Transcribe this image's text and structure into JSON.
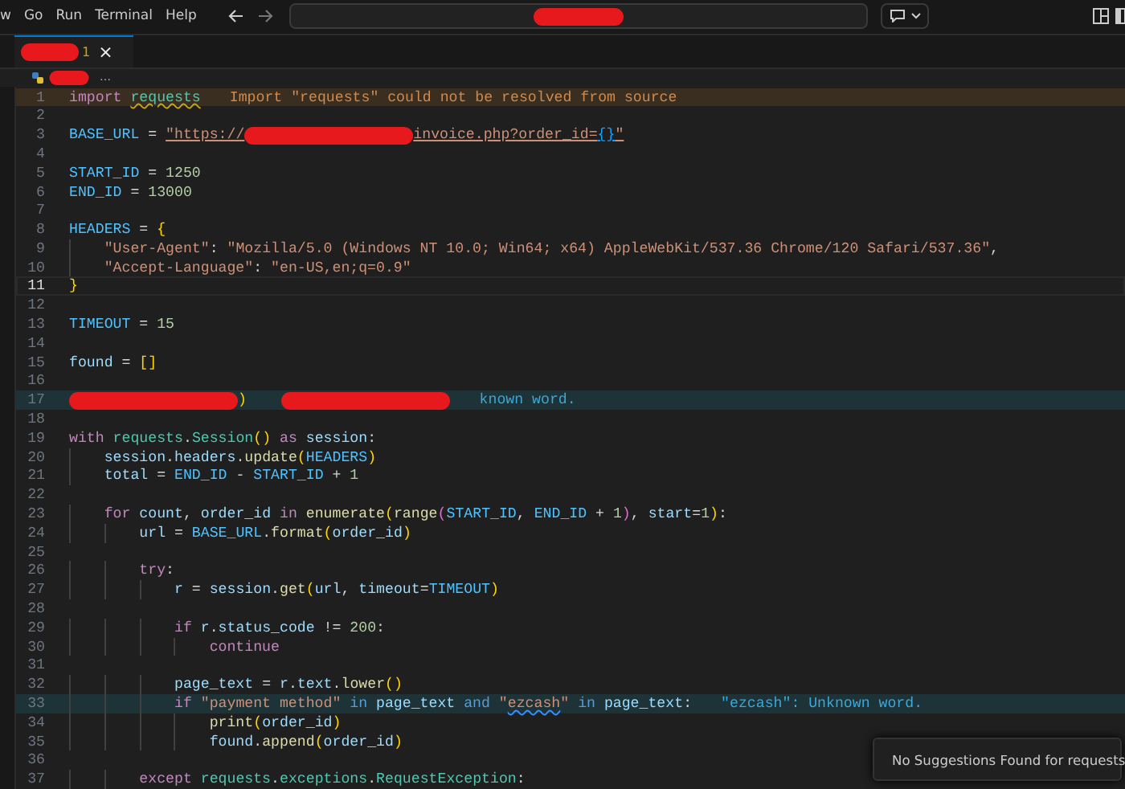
{
  "menu": {
    "items": [
      "w",
      "Go",
      "Run",
      "Terminal",
      "Help"
    ]
  },
  "tab": {
    "problems": "1",
    "close": "×"
  },
  "breadcrumb": {
    "more": "…"
  },
  "editor": {
    "lines": [
      {
        "number": "1",
        "kind": "warning",
        "current": false,
        "tokens": [
          {
            "kind": "kw",
            "text": "import"
          },
          {
            "kind": "mod",
            "text": "requests",
            "space": true,
            "squiggly": true
          }
        ],
        "hint": "Import \"requests\" could not be resolved from source"
      },
      {
        "number": "2",
        "current": false
      },
      {
        "number": "3",
        "current": false,
        "tokens": [
          {
            "kind": "const",
            "text": "BASE_URL"
          },
          {
            "kind": "punc",
            "text": " = "
          },
          {
            "kind": "str",
            "text": "\"https://",
            "underlined": true
          },
          {
            "kind": "redacted"
          },
          {
            "kind": "str",
            "text": "invoice.php?order_id=",
            "underlined": true
          },
          {
            "kind": "br3",
            "text": "{}",
            "underlined": true
          },
          {
            "kind": "str",
            "text": "\"",
            "underlined": true
          }
        ]
      },
      {
        "number": "4",
        "current": false
      },
      {
        "number": "5",
        "current": false,
        "tokens": [
          {
            "kind": "const",
            "text": "START_ID"
          },
          {
            "kind": "punc",
            "text": " = "
          },
          {
            "kind": "num",
            "text": "1250"
          }
        ]
      },
      {
        "number": "6",
        "current": false,
        "tokens": [
          {
            "kind": "const",
            "text": "END_ID"
          },
          {
            "kind": "punc",
            "text": " = "
          },
          {
            "kind": "num",
            "text": "13000"
          }
        ]
      },
      {
        "number": "7",
        "current": false
      },
      {
        "number": "8",
        "current": false,
        "tokens": [
          {
            "kind": "const",
            "text": "HEADERS"
          },
          {
            "kind": "punc",
            "text": " = "
          },
          {
            "kind": "br1",
            "text": "{"
          }
        ],
        "children": [
          {
            "number": "9",
            "current": false,
            "tokens": [
              {
                "kind": "str",
                "text": "\"User-Agent\""
              },
              {
                "kind": "punc",
                "text": ": "
              },
              {
                "kind": "str",
                "text": "\"Mozilla/5.0 (Windows NT 10.0; Win64; x64) AppleWebKit/537.36 Chrome/120 Safari/537.36\""
              },
              {
                "kind": "punc",
                "text": ","
              }
            ]
          },
          {
            "number": "10",
            "current": false,
            "tokens": [
              {
                "kind": "str",
                "text": "\"Accept-Language\""
              },
              {
                "kind": "punc",
                "text": ": "
              },
              {
                "kind": "str",
                "text": "\"en-US,en;q=0.9\""
              }
            ]
          }
        ]
      },
      {
        "number": "11",
        "current": true,
        "tokens": [
          {
            "kind": "br1",
            "text": "}"
          }
        ]
      },
      {
        "number": "12",
        "current": false
      },
      {
        "number": "13",
        "current": false,
        "tokens": [
          {
            "kind": "const",
            "text": "TIMEOUT"
          },
          {
            "kind": "punc",
            "text": " = "
          },
          {
            "kind": "num",
            "text": "15"
          }
        ]
      },
      {
        "number": "14",
        "current": false
      },
      {
        "number": "15",
        "current": false,
        "tokens": [
          {
            "kind": "var",
            "text": "found"
          },
          {
            "kind": "punc",
            "text": " = "
          },
          {
            "kind": "br1",
            "text": "[]"
          }
        ]
      },
      {
        "number": "16",
        "current": false
      },
      {
        "number": "17",
        "kind": "info",
        "current": false,
        "tokens": [
          {
            "kind": "redacted"
          },
          {
            "kind": "br1",
            "text": ")"
          },
          {
            "kind": "redacted",
            "space": true
          }
        ],
        "hint": "known word."
      },
      {
        "number": "18",
        "current": false
      },
      {
        "number": "19",
        "current": false,
        "tokens": [
          {
            "kind": "kw",
            "text": "with"
          },
          {
            "kind": "mod",
            "text": "requests",
            "space": true
          },
          {
            "kind": "punc",
            "text": "."
          },
          {
            "kind": "mod",
            "text": "Session"
          },
          {
            "kind": "br1",
            "text": "()"
          },
          {
            "kind": "kw",
            "text": "as",
            "space": true
          },
          {
            "kind": "var",
            "text": "session",
            "space": true
          },
          {
            "kind": "punc",
            "text": ":"
          }
        ],
        "children": [
          {
            "number": "20",
            "current": false,
            "tokens": [
              {
                "kind": "var",
                "text": "session"
              },
              {
                "kind": "punc",
                "text": "."
              },
              {
                "kind": "var",
                "text": "headers"
              },
              {
                "kind": "punc",
                "text": "."
              },
              {
                "kind": "fn",
                "text": "update"
              },
              {
                "kind": "br1",
                "text": "("
              },
              {
                "kind": "const",
                "text": "HEADERS"
              },
              {
                "kind": "br1",
                "text": ")"
              }
            ]
          },
          {
            "number": "21",
            "current": false,
            "tokens": [
              {
                "kind": "var",
                "text": "total"
              },
              {
                "kind": "punc",
                "text": " = "
              },
              {
                "kind": "const",
                "text": "END_ID"
              },
              {
                "kind": "punc",
                "text": " - "
              },
              {
                "kind": "const",
                "text": "START_ID"
              },
              {
                "kind": "punc",
                "text": " + "
              },
              {
                "kind": "num",
                "text": "1"
              }
            ]
          },
          {
            "number": "22",
            "current": false
          },
          {
            "number": "23",
            "current": false,
            "tokens": [
              {
                "kind": "kw",
                "text": "for"
              },
              {
                "kind": "var",
                "text": "count",
                "space": true
              },
              {
                "kind": "punc",
                "text": ","
              },
              {
                "kind": "var",
                "text": "order_id",
                "space": true
              },
              {
                "kind": "kw",
                "text": "in",
                "space": true
              },
              {
                "kind": "fn",
                "text": "enumerate",
                "space": true
              },
              {
                "kind": "br1",
                "text": "("
              },
              {
                "kind": "fn",
                "text": "range"
              },
              {
                "kind": "br2",
                "text": "("
              },
              {
                "kind": "const",
                "text": "START_ID"
              },
              {
                "kind": "punc",
                "text": ","
              },
              {
                "kind": "const",
                "text": "END_ID",
                "space": true
              },
              {
                "kind": "punc",
                "text": " + "
              },
              {
                "kind": "num",
                "text": "1"
              },
              {
                "kind": "br2",
                "text": ")"
              },
              {
                "kind": "punc",
                "text": ","
              },
              {
                "kind": "var",
                "text": "start",
                "space": true
              },
              {
                "kind": "punc",
                "text": "="
              },
              {
                "kind": "num",
                "text": "1"
              },
              {
                "kind": "br1",
                "text": ")"
              },
              {
                "kind": "punc",
                "text": ":"
              }
            ],
            "children": [
              {
                "number": "24",
                "current": false,
                "tokens": [
                  {
                    "kind": "var",
                    "text": "url"
                  },
                  {
                    "kind": "punc",
                    "text": " = "
                  },
                  {
                    "kind": "const",
                    "text": "BASE_URL"
                  },
                  {
                    "kind": "punc",
                    "text": "."
                  },
                  {
                    "kind": "fn",
                    "text": "format"
                  },
                  {
                    "kind": "br1",
                    "text": "("
                  },
                  {
                    "kind": "var",
                    "text": "order_id"
                  },
                  {
                    "kind": "br1",
                    "text": ")"
                  }
                ]
              },
              {
                "number": "25",
                "current": false
              },
              {
                "number": "26",
                "current": false,
                "tokens": [
                  {
                    "kind": "kw",
                    "text": "try"
                  },
                  {
                    "kind": "punc",
                    "text": ":"
                  }
                ],
                "children": [
                  {
                    "number": "27",
                    "current": false,
                    "tokens": [
                      {
                        "kind": "var",
                        "text": "r"
                      },
                      {
                        "kind": "punc",
                        "text": " = "
                      },
                      {
                        "kind": "var",
                        "text": "session"
                      },
                      {
                        "kind": "punc",
                        "text": "."
                      },
                      {
                        "kind": "fn",
                        "text": "get"
                      },
                      {
                        "kind": "br1",
                        "text": "("
                      },
                      {
                        "kind": "var",
                        "text": "url"
                      },
                      {
                        "kind": "punc",
                        "text": ","
                      },
                      {
                        "kind": "var",
                        "text": "timeout",
                        "space": true
                      },
                      {
                        "kind": "punc",
                        "text": "="
                      },
                      {
                        "kind": "const",
                        "text": "TIMEOUT"
                      },
                      {
                        "kind": "br1",
                        "text": ")"
                      }
                    ]
                  },
                  {
                    "number": "28",
                    "current": false
                  },
                  {
                    "number": "29",
                    "current": false,
                    "tokens": [
                      {
                        "kind": "kw",
                        "text": "if"
                      },
                      {
                        "kind": "var",
                        "text": "r",
                        "space": true
                      },
                      {
                        "kind": "punc",
                        "text": "."
                      },
                      {
                        "kind": "var",
                        "text": "status_code"
                      },
                      {
                        "kind": "punc",
                        "text": " != "
                      },
                      {
                        "kind": "num",
                        "text": "200"
                      },
                      {
                        "kind": "punc",
                        "text": ":"
                      }
                    ],
                    "children": [
                      {
                        "number": "30",
                        "current": false,
                        "tokens": [
                          {
                            "kind": "kw",
                            "text": "continue"
                          }
                        ]
                      }
                    ]
                  },
                  {
                    "number": "31",
                    "current": false
                  },
                  {
                    "number": "32",
                    "current": false,
                    "tokens": [
                      {
                        "kind": "var",
                        "text": "page_text"
                      },
                      {
                        "kind": "punc",
                        "text": " = "
                      },
                      {
                        "kind": "var",
                        "text": "r"
                      },
                      {
                        "kind": "punc",
                        "text": "."
                      },
                      {
                        "kind": "var",
                        "text": "text"
                      },
                      {
                        "kind": "punc",
                        "text": "."
                      },
                      {
                        "kind": "fn",
                        "text": "lower"
                      },
                      {
                        "kind": "br1",
                        "text": "()"
                      }
                    ]
                  },
                  {
                    "number": "33",
                    "kind": "info",
                    "current": false,
                    "tokens": [
                      {
                        "kind": "kw",
                        "text": "if"
                      },
                      {
                        "kind": "str",
                        "text": "\"payment method\"",
                        "space": true
                      },
                      {
                        "kind": "op",
                        "text": "in",
                        "space": true
                      },
                      {
                        "kind": "var",
                        "text": "page_text",
                        "space": true
                      },
                      {
                        "kind": "op",
                        "text": "and",
                        "space": true
                      },
                      {
                        "kind": "str",
                        "text": "\"",
                        "space": true
                      },
                      {
                        "kind": "str",
                        "text": "ezcash",
                        "squiggly": true
                      },
                      {
                        "kind": "str",
                        "text": "\""
                      },
                      {
                        "kind": "op",
                        "text": "in",
                        "space": true
                      },
                      {
                        "kind": "var",
                        "text": "page_text",
                        "space": true
                      },
                      {
                        "kind": "punc",
                        "text": ":"
                      }
                    ],
                    "hint": "\"ezcash\": Unknown word.",
                    "children": [
                      {
                        "number": "34",
                        "current": false,
                        "tokens": [
                          {
                            "kind": "fn",
                            "text": "print"
                          },
                          {
                            "kind": "br1",
                            "text": "("
                          },
                          {
                            "kind": "var",
                            "text": "order_id"
                          },
                          {
                            "kind": "br1",
                            "text": ")"
                          }
                        ]
                      },
                      {
                        "number": "35",
                        "current": false,
                        "tokens": [
                          {
                            "kind": "var",
                            "text": "found"
                          },
                          {
                            "kind": "punc",
                            "text": "."
                          },
                          {
                            "kind": "fn",
                            "text": "append"
                          },
                          {
                            "kind": "br1",
                            "text": "("
                          },
                          {
                            "kind": "var",
                            "text": "order_id"
                          },
                          {
                            "kind": "br1",
                            "text": ")"
                          }
                        ]
                      }
                    ]
                  },
                  {
                    "number": "36",
                    "current": false
                  }
                ]
              },
              {
                "number": "37",
                "current": false,
                "tokens": [
                  {
                    "kind": "kw",
                    "text": "except"
                  },
                  {
                    "kind": "mod",
                    "text": "requests",
                    "space": true
                  },
                  {
                    "kind": "punc",
                    "text": "."
                  },
                  {
                    "kind": "mod",
                    "text": "exceptions"
                  },
                  {
                    "kind": "punc",
                    "text": "."
                  },
                  {
                    "kind": "mod",
                    "text": "RequestException"
                  },
                  {
                    "kind": "punc",
                    "text": ":"
                  }
                ]
              }
            ]
          }
        ]
      }
    ]
  },
  "notification": {
    "message": "No Suggestions Found for requests"
  }
}
